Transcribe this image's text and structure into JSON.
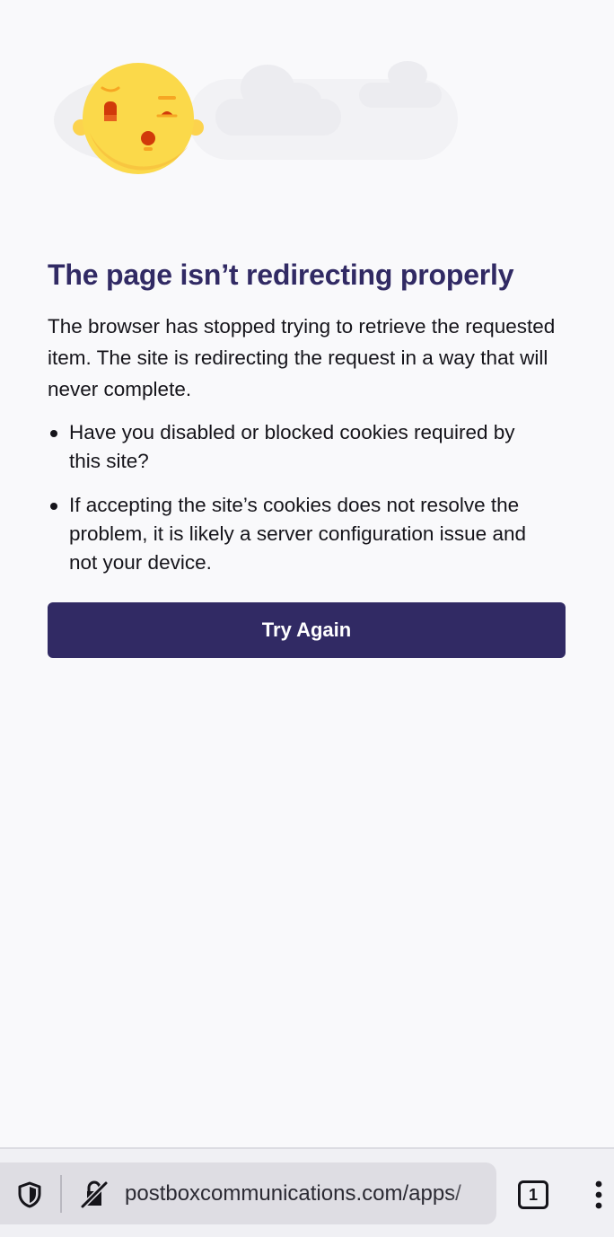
{
  "error": {
    "title": "The page isn’t redirecting properly",
    "description": "The browser has stopped trying to retrieve the requested item. The site is redirecting the request in a way that will never complete.",
    "tips": [
      "Have you disabled or blocked cookies required by this site?",
      "If accepting the site’s cookies does not resolve the problem, it is likely a server configuration issue and not your device."
    ],
    "button_label": "Try Again"
  },
  "toolbar": {
    "url": "postboxcommunications.com/apps/",
    "tab_count": "1",
    "icons": {
      "shield": "tracking-protection-shield-icon",
      "insecure": "insecure-connection-icon",
      "menu": "kebab-menu-icon"
    }
  },
  "colors": {
    "accent": "#312a64",
    "background": "#f9f9fb",
    "text": "#15141a",
    "toolbar": "#f0f0f4",
    "url_bar": "#dedde3"
  }
}
